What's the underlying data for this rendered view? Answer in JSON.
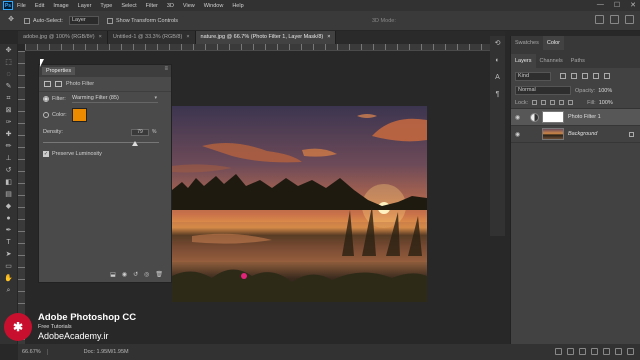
{
  "menubar": {
    "logo": "Ps",
    "items": [
      "File",
      "Edit",
      "Image",
      "Layer",
      "Type",
      "Select",
      "Filter",
      "3D",
      "View",
      "Window",
      "Help"
    ],
    "window_controls": [
      "—",
      "☐",
      "✕"
    ]
  },
  "options": {
    "auto_select_label": "Auto-Select:",
    "auto_select_value": "Layer",
    "show_transform_label": "Show Transform Controls",
    "mode_3d_label": "3D Mode:"
  },
  "tabs": [
    {
      "label": "adobe.jpg @ 100% (RGB/8#)",
      "active": false
    },
    {
      "label": "Untitled-1 @ 33.3% (RGB/8)",
      "active": false
    },
    {
      "label": "nature.jpg @ 66.7% (Photo Filter 1, Layer Mask/8)",
      "active": true
    }
  ],
  "properties": {
    "tab_label": "Properties",
    "adjustment_title": "Photo Filter",
    "filter_label": "Filter:",
    "filter_value": "Warming Filter (85)",
    "color_label": "Color:",
    "color_swatch": "#ec8a00",
    "density_label": "Density:",
    "density_value": "79",
    "density_unit": "%",
    "density_fraction": 0.79,
    "preserve_luminosity_label": "Preserve Luminosity",
    "preserve_luminosity_checked": true
  },
  "right_panel": {
    "top_tabs": [
      "Swatches",
      "Color"
    ],
    "layer_tabs": [
      "Layers",
      "Channels",
      "Paths"
    ],
    "kind_label": "Kind",
    "blend_mode": "Normal",
    "opacity_label": "Opacity:",
    "opacity_value": "100%",
    "lock_label": "Lock:",
    "fill_label": "Fill:",
    "fill_value": "100%",
    "layers": [
      {
        "name": "Photo Filter 1",
        "type": "adjustment",
        "selected": true
      },
      {
        "name": "Background",
        "type": "image",
        "selected": false
      }
    ]
  },
  "status": {
    "zoom": "66.67%",
    "doc_info": "Doc: 1.95M/1.95M"
  },
  "watermark": {
    "title": "Adobe Photoshop CC",
    "subtitle": "Free Tutorials",
    "url": "AdobeAcademy.ir"
  },
  "colors": {
    "accent_blue": "#31a8ff",
    "filter_orange": "#ec8a00",
    "watermark_red": "#c8102e"
  }
}
